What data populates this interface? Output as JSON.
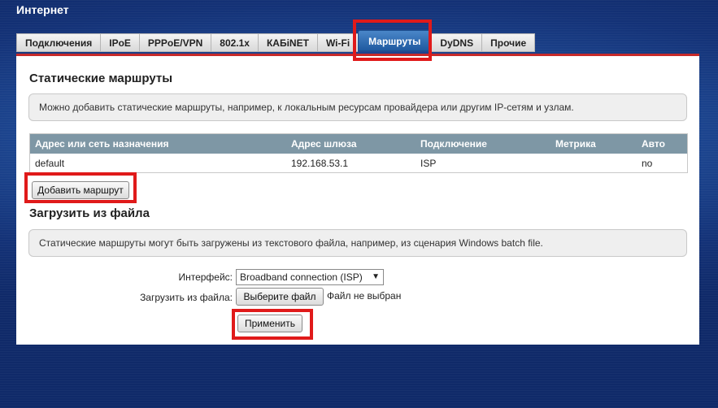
{
  "page": {
    "title": "Интернет"
  },
  "tabs": [
    {
      "label": "Подключения"
    },
    {
      "label": "IPoE"
    },
    {
      "label": "PPPoE/VPN"
    },
    {
      "label": "802.1x"
    },
    {
      "label": "КАБiNET"
    },
    {
      "label": "Wi-Fi"
    },
    {
      "label": "Маршруты"
    },
    {
      "label": "DyDNS"
    },
    {
      "label": "Прочие"
    }
  ],
  "static_routes": {
    "title": "Статические маршруты",
    "info": "Можно добавить статические маршруты, например, к локальным ресурсам провайдера или другим IP-сетям и узлам.",
    "columns": [
      "Адрес или сеть назначения",
      "Адрес шлюза",
      "Подключение",
      "Метрика",
      "Авто"
    ],
    "rows": [
      {
        "destination": "default",
        "gateway": "192.168.53.1",
        "connection": "ISP",
        "metric": "",
        "auto": "no"
      }
    ],
    "add_button": "Добавить маршрут"
  },
  "load_file": {
    "title": "Загрузить из файла",
    "info": "Статические маршруты могут быть загружены из текстового файла, например, из сценария Windows batch file.",
    "interface_label": "Интерфейс:",
    "interface_value": "Broadband connection (ISP)",
    "file_label": "Загрузить из файла:",
    "choose_button": "Выберите файл",
    "no_file": "Файл не выбран",
    "apply_button": "Применить"
  },
  "colors": {
    "accent_red": "#c62a2a",
    "highlight": "#e01a1a",
    "active_tab": "#2a66ab",
    "table_header": "#7e97a5"
  }
}
